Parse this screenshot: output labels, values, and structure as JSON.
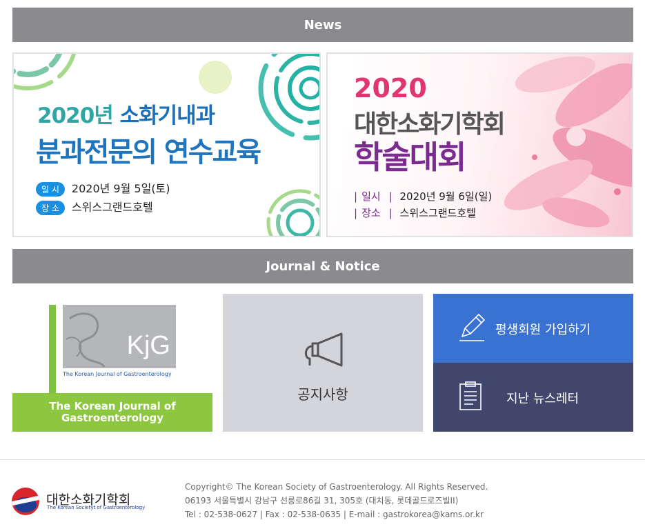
{
  "news": {
    "title": "News"
  },
  "banner_left": {
    "title_part1": "2020년 ",
    "title_part2": "소화기내과",
    "title_line2": "분과전문의 연수교육",
    "date_label": "일 시",
    "date": "2020년 9월 5일(토)",
    "place_label": "장 소",
    "place": "스위스그랜드호텔"
  },
  "banner_right": {
    "year": "2020",
    "title_line1": "대한소화기학회",
    "title_line2": "학술대회",
    "bar": "|",
    "date_label": "일시",
    "date": "2020년 9월 6일(일)",
    "place_label": "장소",
    "place": "스위스그랜드호텔"
  },
  "journal": {
    "title": "Journal & Notice",
    "cover_mark": "KjG",
    "cover_subtitle": "The Korean Journal of Gastroenterology",
    "caption": "The Korean Journal of Gastroenterology"
  },
  "notice": {
    "label": "공지사항",
    "icon": "megaphone-icon"
  },
  "member": {
    "label": "평생회원 가입하기",
    "icon": "pencil-icon"
  },
  "newsletter": {
    "label": "지난 뉴스레터",
    "icon": "clipboard-icon"
  },
  "colors": {
    "section_bar": "#8b8b8f",
    "journal_green": "#8dc63f",
    "member_blue": "#3a72d1",
    "newsletter_navy": "#40466c",
    "notice_gray": "#d4d5da"
  },
  "footer": {
    "org_name": "대한소화기학회",
    "org_name_en": "The Korean Societyt of Gastroenterology",
    "copyright": "Copyright© The Korean Society of Gastroenterology. All Rights Reserved.",
    "address": "06193 서울특별시 강남구 선릉로86길 31, 305호 (대치동, 롯데골드로즈빌II)",
    "contact": "Tel : 02-538-0627 | Fax : 02-538-0635 | E-mail : gastrokorea@kams.or.kr"
  }
}
